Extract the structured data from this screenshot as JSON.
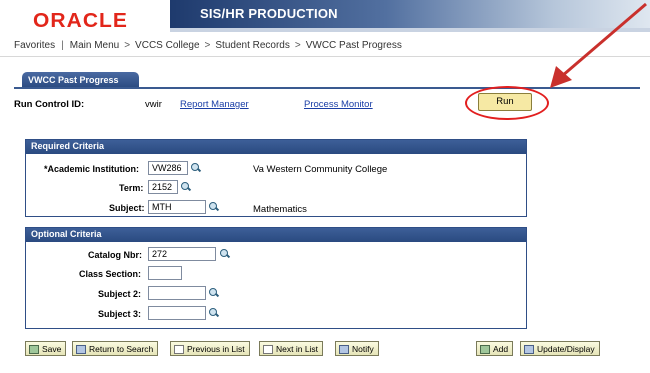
{
  "header": {
    "logo": "ORACLE",
    "banner_title": "SIS/HR PRODUCTION"
  },
  "breadcrumb": {
    "favorites": "Favorites",
    "main_menu": "Main Menu",
    "vccs_college": "VCCS College",
    "student_records": "Student Records",
    "current": "VWCC Past Progress"
  },
  "page": {
    "tab_label": "VWCC Past Progress",
    "run_control_label": "Run Control ID:",
    "run_control_value": "vwir",
    "report_manager": "Report Manager",
    "process_monitor": "Process Monitor",
    "run_button": "Run"
  },
  "required": {
    "title": "Required Criteria",
    "institution_label": "*Academic Institution:",
    "institution_value": "VW286",
    "institution_desc": "Va Western Community College",
    "term_label": "Term:",
    "term_value": "2152",
    "subject_label": "Subject:",
    "subject_value": "MTH",
    "subject_desc": "Mathematics"
  },
  "optional": {
    "title": "Optional Criteria",
    "catalog_label": "Catalog Nbr:",
    "catalog_value": "272",
    "class_section_label": "Class Section:",
    "class_section_value": "",
    "subject2_label": "Subject 2:",
    "subject2_value": "",
    "subject3_label": "Subject 3:",
    "subject3_value": ""
  },
  "toolbar": {
    "save": "Save",
    "return_to_search": "Return to Search",
    "previous_in_list": "Previous in List",
    "next_in_list": "Next in List",
    "notify": "Notify",
    "add": "Add",
    "update_display": "Update/Display"
  },
  "colors": {
    "logo_red": "#e2261a",
    "banner_blue": "#1e3a6d",
    "link_blue": "#1a3ea6",
    "annotation_red": "#e21f1f",
    "run_button_fill": "#f6e9a4"
  }
}
